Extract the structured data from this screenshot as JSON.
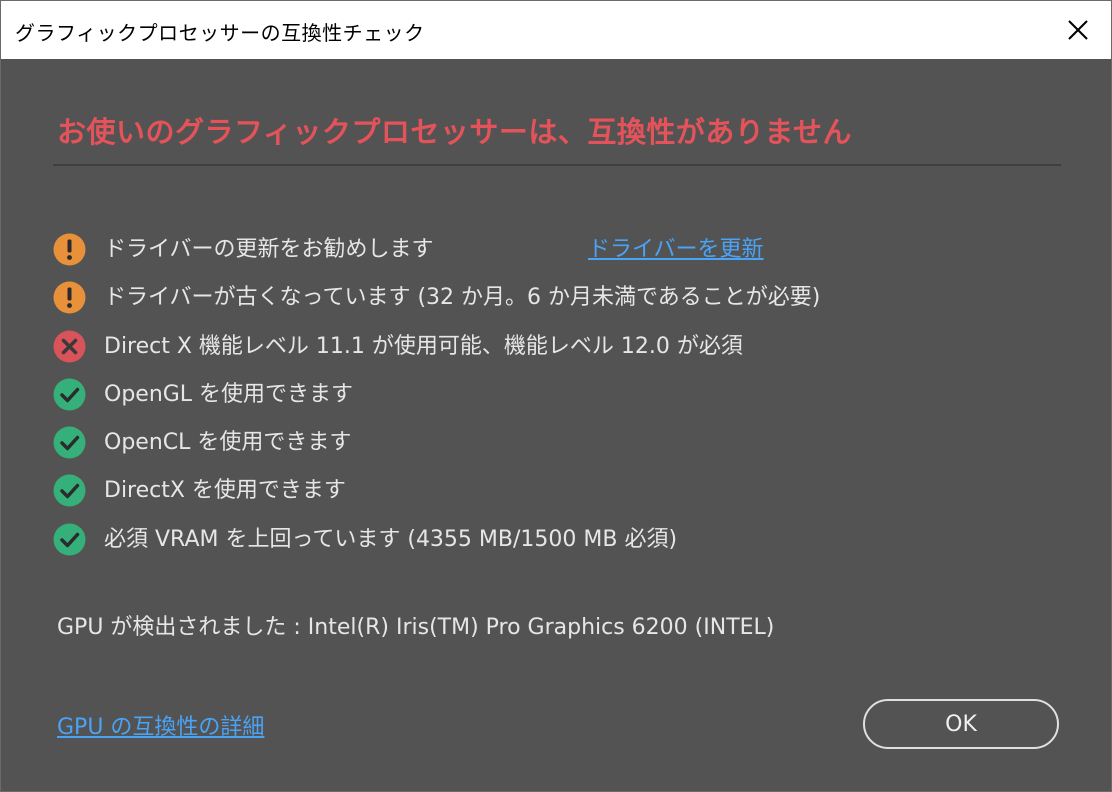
{
  "window": {
    "title": "グラフィックプロセッサーの互換性チェック"
  },
  "heading": "お使いのグラフィックプロセッサーは、互換性がありません",
  "checks": [
    {
      "status": "warning",
      "icon": "warning-icon",
      "text": "ドライバーの更新をお勧めします"
    },
    {
      "status": "warning",
      "icon": "warning-icon",
      "text": "ドライバーが古くなっています (32 か月。6 か月未満であることが必要)"
    },
    {
      "status": "error",
      "icon": "error-icon",
      "text": "Direct X 機能レベル 11.1 が使用可能、機能レベル 12.0 が必須"
    },
    {
      "status": "ok",
      "icon": "check-icon",
      "text": "OpenGL を使用できます"
    },
    {
      "status": "ok",
      "icon": "check-icon",
      "text": "OpenCL を使用できます"
    },
    {
      "status": "ok",
      "icon": "check-icon",
      "text": "DirectX を使用できます"
    },
    {
      "status": "ok",
      "icon": "check-icon",
      "text": "必須 VRAM を上回っています (4355 MB/1500 MB 必須)"
    }
  ],
  "update_driver_link": "ドライバーを更新",
  "gpu_detected": "GPU が検出されました : Intel(R) Iris(TM) Pro Graphics 6200 (INTEL)",
  "details_link": "GPU の互換性の詳細",
  "ok_button": "OK",
  "colors": {
    "heading": "#e4535a",
    "link": "#4aa3f5",
    "warning": "#e8913a",
    "error": "#d9535a",
    "ok": "#35b07a"
  }
}
